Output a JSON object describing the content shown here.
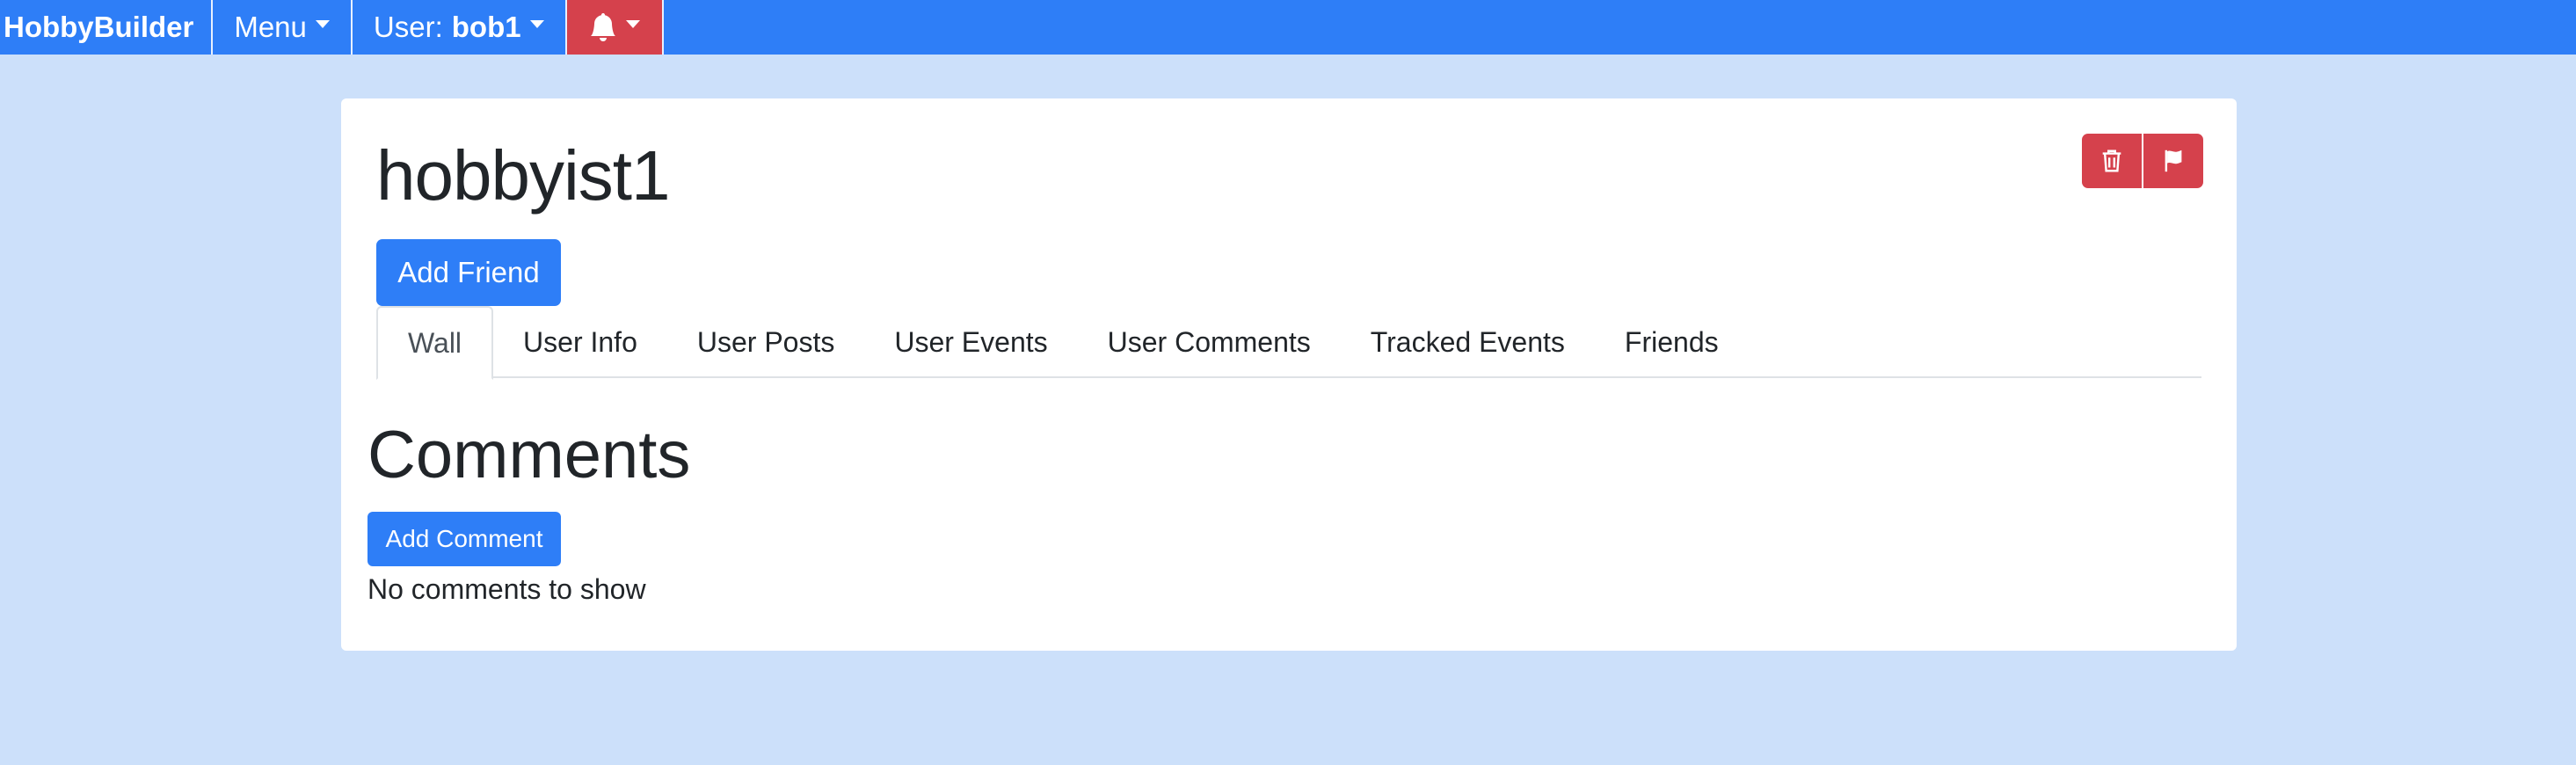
{
  "navbar": {
    "brand": "HobbyBuilder",
    "menu_label": "Menu",
    "user_prefix": "User:",
    "username": "bob1",
    "notifications_icon": "bell-icon",
    "color": "#2e7ef7",
    "alert_color": "#d5414c"
  },
  "profile": {
    "title": "hobbyist1",
    "add_friend_label": "Add Friend",
    "delete_icon": "trash-icon",
    "report_icon": "flag-icon"
  },
  "tabs": [
    {
      "label": "Wall",
      "active": true
    },
    {
      "label": "User Info",
      "active": false
    },
    {
      "label": "User Posts",
      "active": false
    },
    {
      "label": "User Events",
      "active": false
    },
    {
      "label": "User Comments",
      "active": false
    },
    {
      "label": "Tracked Events",
      "active": false
    },
    {
      "label": "Friends",
      "active": false
    }
  ],
  "wall": {
    "heading": "Comments",
    "add_comment_label": "Add Comment",
    "empty_message": "No comments to show"
  }
}
